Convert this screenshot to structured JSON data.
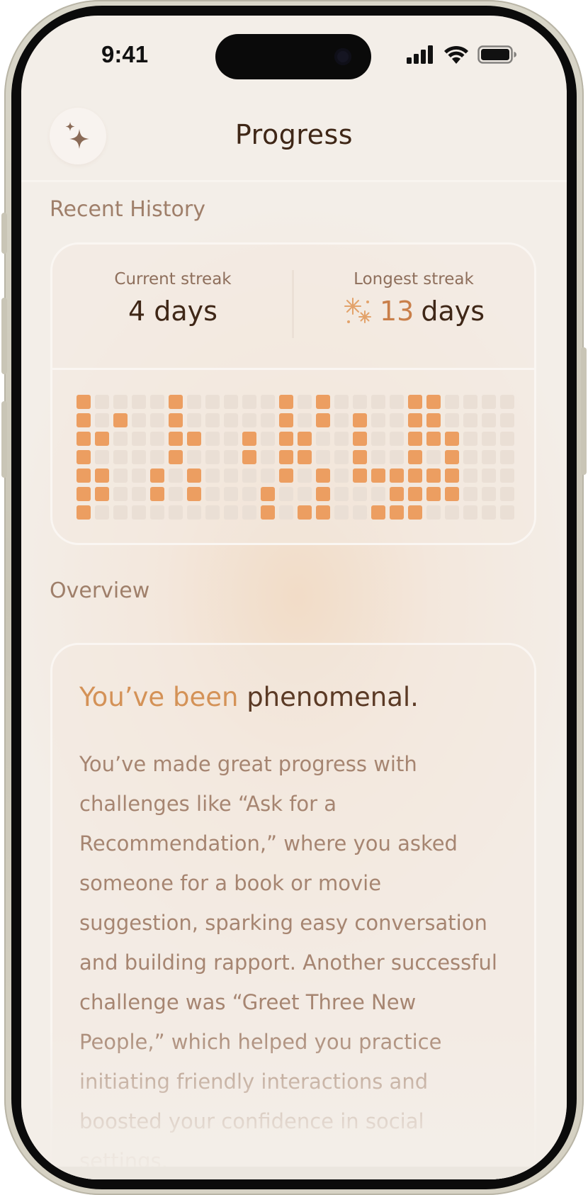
{
  "status_bar": {
    "time": "9:41",
    "icons": [
      "cellular-signal-icon",
      "wifi-icon",
      "battery-icon"
    ]
  },
  "header": {
    "title": "Progress",
    "ai_icon": "sparkles-icon"
  },
  "recent_history": {
    "section_label": "Recent History",
    "current_streak": {
      "label": "Current streak",
      "value": "4 days"
    },
    "longest_streak": {
      "label": "Longest streak",
      "number": "13",
      "unit": "days",
      "icon": "fireworks-icon"
    },
    "calendar": {
      "columns": 24,
      "rows": 7,
      "active_color": "#ec9e61",
      "inactive_color": "#eadfd5",
      "active_cells": [
        [
          0,
          0
        ],
        [
          0,
          1
        ],
        [
          0,
          2
        ],
        [
          0,
          3
        ],
        [
          0,
          4
        ],
        [
          0,
          5
        ],
        [
          0,
          6
        ],
        [
          1,
          2
        ],
        [
          1,
          4
        ],
        [
          1,
          5
        ],
        [
          2,
          1
        ],
        [
          4,
          4
        ],
        [
          4,
          5
        ],
        [
          5,
          0
        ],
        [
          5,
          1
        ],
        [
          5,
          2
        ],
        [
          5,
          3
        ],
        [
          6,
          2
        ],
        [
          6,
          4
        ],
        [
          6,
          5
        ],
        [
          9,
          2
        ],
        [
          9,
          3
        ],
        [
          10,
          5
        ],
        [
          10,
          6
        ],
        [
          11,
          0
        ],
        [
          11,
          1
        ],
        [
          11,
          2
        ],
        [
          11,
          3
        ],
        [
          11,
          4
        ],
        [
          12,
          2
        ],
        [
          12,
          3
        ],
        [
          12,
          6
        ],
        [
          13,
          0
        ],
        [
          13,
          1
        ],
        [
          13,
          4
        ],
        [
          13,
          5
        ],
        [
          13,
          6
        ],
        [
          15,
          1
        ],
        [
          15,
          2
        ],
        [
          15,
          3
        ],
        [
          15,
          4
        ],
        [
          16,
          4
        ],
        [
          16,
          6
        ],
        [
          17,
          4
        ],
        [
          17,
          5
        ],
        [
          17,
          6
        ],
        [
          18,
          0
        ],
        [
          18,
          1
        ],
        [
          18,
          2
        ],
        [
          18,
          3
        ],
        [
          18,
          4
        ],
        [
          18,
          5
        ],
        [
          18,
          6
        ],
        [
          19,
          0
        ],
        [
          19,
          1
        ],
        [
          19,
          2
        ],
        [
          19,
          4
        ],
        [
          19,
          5
        ],
        [
          20,
          2
        ],
        [
          20,
          3
        ],
        [
          20,
          4
        ],
        [
          20,
          5
        ]
      ]
    }
  },
  "overview": {
    "section_label": "Overview",
    "headline_accent": "You’ve been",
    "headline_rest": "phenomenal.",
    "body": "You’ve made great progress with challenges like “Ask for a Recommendation,” where you asked someone for a book or movie suggestion, sparking easy conversation and building rapport. Another successful challenge was “Greet Three New People,” which helped you practice initiating friendly interactions and boosted your confidence in social settings."
  },
  "colors": {
    "accent": "#d49257",
    "title_text": "#3f2717",
    "muted_text": "#a68571"
  }
}
